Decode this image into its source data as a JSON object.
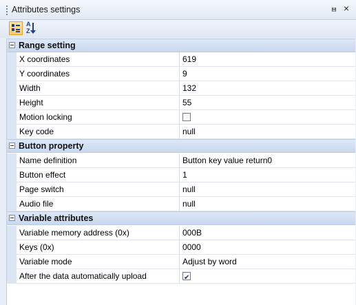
{
  "window": {
    "title": "Attributes settings",
    "pin_glyph": "⩏",
    "close_glyph": "×"
  },
  "toolbar": {
    "categorized_icon": "categorized-view-icon",
    "alphabetical_icon": "alphabetical-sort-icon",
    "alpha_top": "A",
    "alpha_bottom": "Z"
  },
  "categories": [
    {
      "label": "Range setting",
      "rows": [
        {
          "name": "X coordinates",
          "value": "619"
        },
        {
          "name": "Y coordinates",
          "value": "9"
        },
        {
          "name": "Width",
          "value": "132"
        },
        {
          "name": "Height",
          "value": "55"
        },
        {
          "name": "Motion locking",
          "checkbox": false
        },
        {
          "name": "Key code",
          "value": "null"
        }
      ]
    },
    {
      "label": "Button property",
      "rows": [
        {
          "name": "Name definition",
          "value": "Button key value return0"
        },
        {
          "name": "Button effect",
          "value": "1"
        },
        {
          "name": "Page switch",
          "value": "null"
        },
        {
          "name": "Audio file",
          "value": "null"
        }
      ]
    },
    {
      "label": "Variable attributes",
      "rows": [
        {
          "name": "Variable memory address (0x)",
          "value": "000B"
        },
        {
          "name": "Keys (0x)",
          "value": "0000"
        },
        {
          "name": "Variable mode",
          "value": "Adjust by word"
        },
        {
          "name": "After the data automatically upload",
          "checkbox": true
        }
      ]
    }
  ],
  "colors": {
    "panel_bg": "#e8eef7",
    "category_bg": "#c9d8ef",
    "selected_button": "#ffc865"
  }
}
